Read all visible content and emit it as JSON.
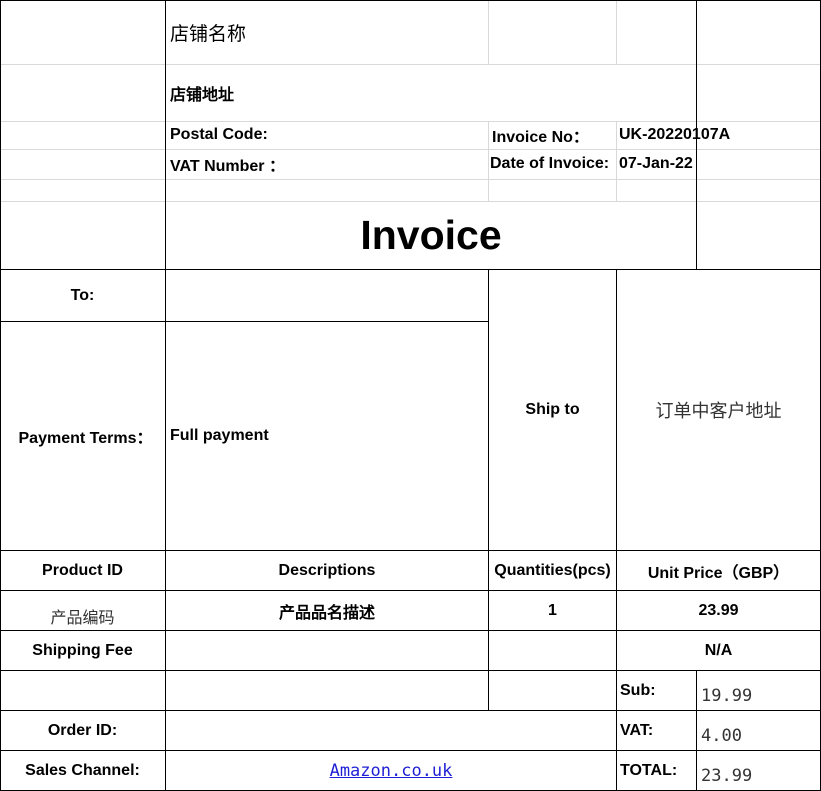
{
  "header": {
    "shop_name": "店铺名称",
    "shop_address": "店铺地址",
    "postal_code_label": "Postal Code:",
    "vat_number_label": "VAT  Number ：",
    "invoice_no_label": "Invoice No：",
    "invoice_no_value": "UK-20220107A",
    "date_label": "Date of Invoice:",
    "date_value": "07-Jan-22"
  },
  "title": "Invoice",
  "parties": {
    "to_label": "To:",
    "payment_terms_label": "Payment Terms：",
    "payment_terms_value": "Full payment",
    "ship_to_label": "Ship to",
    "ship_to_value": "订单中客户地址"
  },
  "table": {
    "headers": [
      "Product ID",
      "Descriptions",
      "Quantities(pcs)",
      "Unit Price（GBP）"
    ],
    "rows": [
      {
        "product_id": "产品编码",
        "description": "产品品名描述",
        "quantity": "1",
        "unit_price": "23.99"
      }
    ],
    "shipping_fee_label": "Shipping Fee",
    "shipping_fee_value": "N/A"
  },
  "totals": {
    "sub_label": "Sub:",
    "sub_value": "19.99",
    "vat_label": "VAT:",
    "vat_value": "4.00",
    "total_label": "TOTAL:",
    "total_value": "23.99"
  },
  "order": {
    "order_id_label": "Order ID:",
    "sales_channel_label": "Sales Channel:",
    "sales_channel_value": "Amazon.co.uk "
  }
}
